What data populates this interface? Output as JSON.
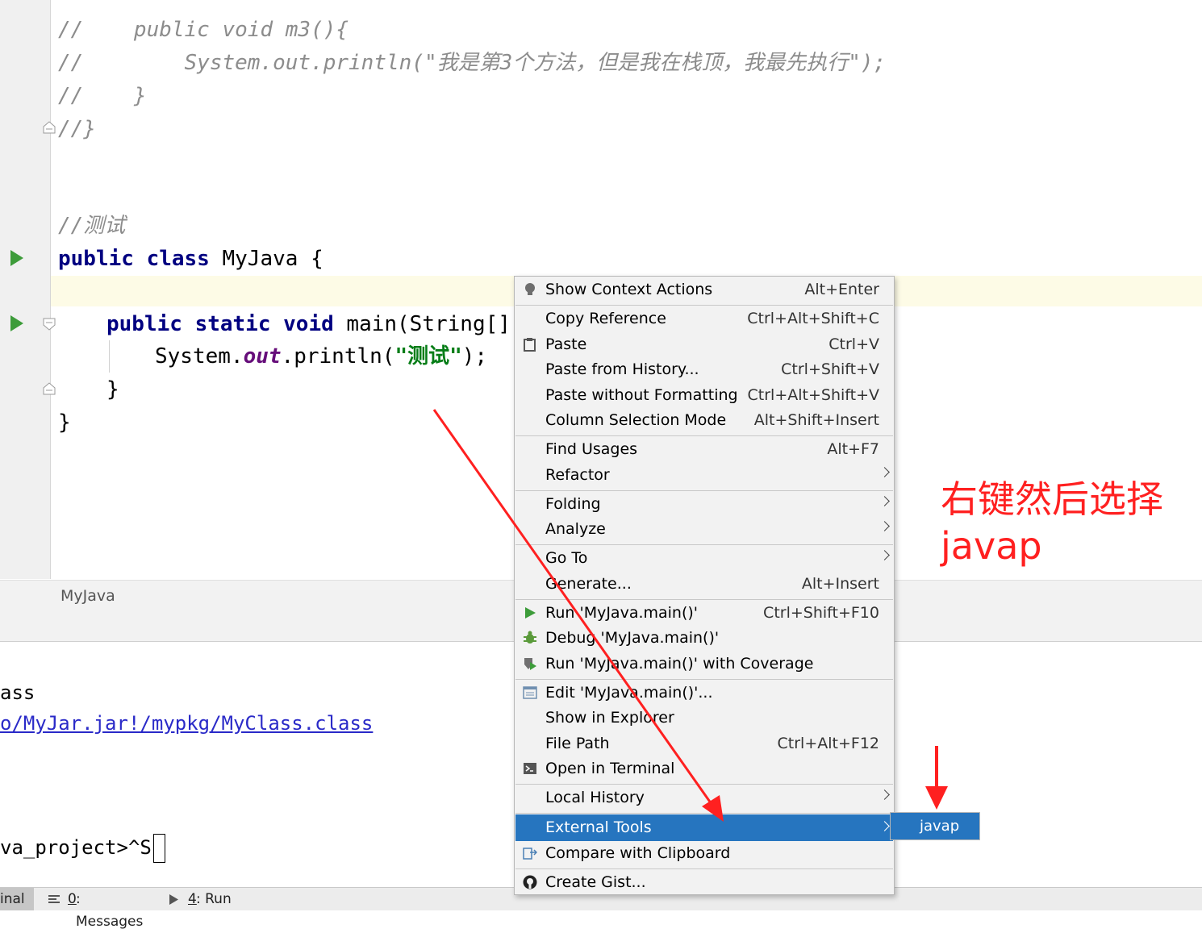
{
  "editor": {
    "lines": [
      {
        "kind": "comment",
        "text": "//    public void m3(){"
      },
      {
        "kind": "comment",
        "text": "//        System.out.println(\"我是第3个方法，但是我在栈顶，我最先执行\");"
      },
      {
        "kind": "comment",
        "text": "//    }"
      },
      {
        "kind": "comment",
        "text": "//}"
      },
      {
        "kind": "comment",
        "text": "//测试"
      },
      {
        "kw": "public class",
        "rest": " MyJava {"
      },
      {
        "kw": "public static void",
        "rest": " main(String[] a"
      },
      {
        "prefix": "System.",
        "field": "out",
        "mid": ".println(",
        "str": "\"测试\"",
        "suffix": ");"
      },
      {
        "text": "}"
      },
      {
        "text": "}"
      }
    ],
    "breadcrumb": "MyJava"
  },
  "terminal": {
    "line1": "ass",
    "line2": "o/MyJar.jar!/mypkg/MyClass.class",
    "line3": "va_project>^S"
  },
  "bottom_tabs": [
    {
      "label": "inal"
    },
    {
      "mnemonic": "0",
      "label": ": Messages"
    },
    {
      "mnemonic": "4",
      "label": ": Run"
    }
  ],
  "context_menu": {
    "items": [
      {
        "label": "Show Context Actions",
        "shortcut": "Alt+Enter",
        "icon": "lightbulb-icon"
      },
      {
        "label": "Copy Reference",
        "shortcut": "Ctrl+Alt+Shift+C"
      },
      {
        "label": "Paste",
        "shortcut": "Ctrl+V",
        "icon": "clipboard-icon"
      },
      {
        "label": "Paste from History...",
        "shortcut": "Ctrl+Shift+V"
      },
      {
        "label": "Paste without Formatting",
        "shortcut": "Ctrl+Alt+Shift+V"
      },
      {
        "label": "Column Selection Mode",
        "shortcut": "Alt+Shift+Insert"
      },
      {
        "label": "Find Usages",
        "shortcut": "Alt+F7"
      },
      {
        "label": "Refactor",
        "submenu": true
      },
      {
        "label": "Folding",
        "submenu": true
      },
      {
        "label": "Analyze",
        "submenu": true
      },
      {
        "label": "Go To",
        "submenu": true
      },
      {
        "label": "Generate...",
        "shortcut": "Alt+Insert"
      },
      {
        "label": "Run 'MyJava.main()'",
        "shortcut": "Ctrl+Shift+F10",
        "icon": "run-icon"
      },
      {
        "label": "Debug 'MyJava.main()'",
        "icon": "debug-icon"
      },
      {
        "label": "Run 'MyJava.main()' with Coverage",
        "icon": "coverage-icon"
      },
      {
        "label": "Edit 'MyJava.main()'...",
        "icon": "edit-config-icon"
      },
      {
        "label": "Show in Explorer"
      },
      {
        "label": "File Path",
        "shortcut": "Ctrl+Alt+F12"
      },
      {
        "label": "Open in Terminal",
        "icon": "terminal-icon"
      },
      {
        "label": "Local History",
        "submenu": true
      },
      {
        "label": "External Tools",
        "submenu": true,
        "selected": true
      },
      {
        "label": "Compare with Clipboard",
        "icon": "compare-icon"
      },
      {
        "label": "Create Gist...",
        "icon": "github-icon"
      }
    ]
  },
  "submenu": {
    "items": [
      {
        "label": "javap"
      }
    ]
  },
  "annotation": {
    "text": "右键然后选择\njavap",
    "color": "#ff2020"
  },
  "colors": {
    "accent": "#2675bf",
    "run_green": "#3d9c3a",
    "caret_line": "#fdfbe6"
  }
}
